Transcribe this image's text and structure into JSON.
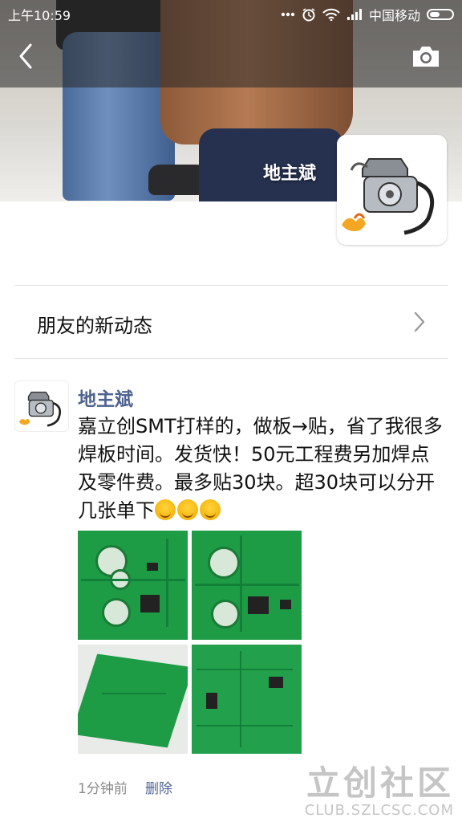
{
  "status_bar": {
    "time": "上午10:59",
    "carrier": "中国移动",
    "icons": [
      "more-dots-icon",
      "alarm-icon",
      "wifi-icon",
      "signal-icon",
      "battery-icon"
    ]
  },
  "header": {
    "back_icon": "chevron-left-icon",
    "camera_icon": "camera-icon"
  },
  "profile": {
    "name": "地主斌",
    "avatar_icon": "engine-avatar-icon"
  },
  "friends_updates": {
    "label": "朋友的新动态",
    "chevron_icon": "chevron-right-icon"
  },
  "post": {
    "author": "地主斌",
    "text": "嘉立创SMT打样的，做板→贴，省了我很多焊板时间。发货快！50元工程费另加焊点及零件费。最多贴30块。超30块可以分开几张单下",
    "emoji_count": 3,
    "emoji_icon": "smiling-face-icon",
    "photos": [
      "pcb-photo-1",
      "pcb-photo-2",
      "pcb-photo-3",
      "pcb-photo-4"
    ],
    "time": "1分钟前",
    "delete_label": "删除"
  },
  "watermark": {
    "big": "立创社区",
    "small": "CLUB.SZLCSC.COM"
  },
  "colors": {
    "link_blue": "#4f6391",
    "pcb_green": "#1e9b45"
  }
}
